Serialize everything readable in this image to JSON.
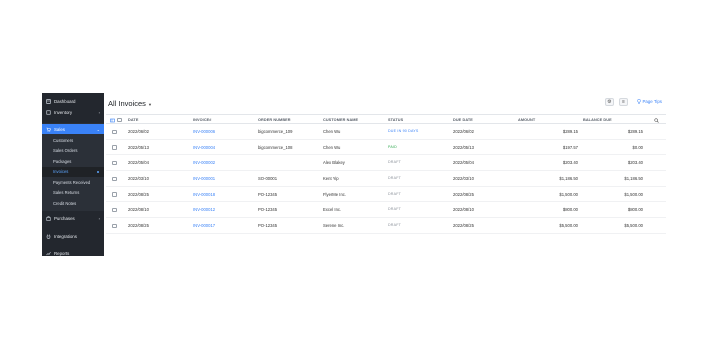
{
  "sidebar": {
    "items": [
      {
        "label": "Dashboard",
        "icon": "dashboard-icon"
      },
      {
        "label": "Inventory",
        "icon": "inventory-icon"
      },
      {
        "label": "Sales",
        "icon": "cart-icon"
      },
      {
        "label": "Purchases",
        "icon": "bag-icon"
      },
      {
        "label": "Integrations",
        "icon": "plug-icon"
      },
      {
        "label": "Reports",
        "icon": "chart-icon"
      }
    ],
    "sales_sub": [
      "Customers",
      "Sales Orders",
      "Packages",
      "Invoices",
      "Payments Received",
      "Sales Returns",
      "Credit Notes"
    ]
  },
  "header": {
    "title": "All Invoices",
    "page_tips": "Page Tips"
  },
  "table": {
    "columns": [
      "DATE",
      "INVOICE#",
      "ORDER NUMBER",
      "CUSTOMER NAME",
      "STATUS",
      "DUE DATE",
      "AMOUNT",
      "BALANCE DUE"
    ],
    "rows": [
      {
        "date": "2022/06/02",
        "invoice": "INV-000006",
        "order": "bigcommerce_109",
        "customer": "Chen Wu",
        "status": "DUE IN 90 DAYS",
        "due": "2022/06/02",
        "amount": "$289.15",
        "balance": "$289.15"
      },
      {
        "date": "2022/05/13",
        "invoice": "INV-000004",
        "order": "bigcommerce_108",
        "customer": "Chen Wu",
        "status": "PAID",
        "due": "2022/05/13",
        "amount": "$197.57",
        "balance": "$0.00"
      },
      {
        "date": "2022/05/04",
        "invoice": "INV-000002",
        "order": "",
        "customer": "Alex Blakey",
        "status": "DRAFT",
        "due": "2022/05/04",
        "amount": "$203.40",
        "balance": "$203.40"
      },
      {
        "date": "2022/03/10",
        "invoice": "INV-000001",
        "order": "SO-00001",
        "customer": "Kent Yip",
        "status": "DRAFT",
        "due": "2022/03/10",
        "amount": "$1,186.50",
        "balance": "$1,186.50"
      },
      {
        "date": "2022/08/25",
        "invoice": "INV-000018",
        "order": "PO-12345",
        "customer": "FlyerMe Inc.",
        "status": "DRAFT",
        "due": "2022/08/25",
        "amount": "$1,500.00",
        "balance": "$1,500.00"
      },
      {
        "date": "2022/08/10",
        "invoice": "INV-000012",
        "order": "PO-12345",
        "customer": "Excel Inc.",
        "status": "DRAFT",
        "due": "2022/08/10",
        "amount": "$800.00",
        "balance": "$800.00"
      },
      {
        "date": "2022/08/25",
        "invoice": "INV-000017",
        "order": "PO-12345",
        "customer": "Serene Inc.",
        "status": "DRAFT",
        "due": "2022/08/25",
        "amount": "$5,500.00",
        "balance": "$5,500.00"
      }
    ]
  },
  "colors": {
    "sidebar_bg": "#23272e",
    "accent": "#3a82f7",
    "status_due": "#3a82f7",
    "status_paid": "#2fa84f",
    "status_draft": "#8a9099"
  }
}
